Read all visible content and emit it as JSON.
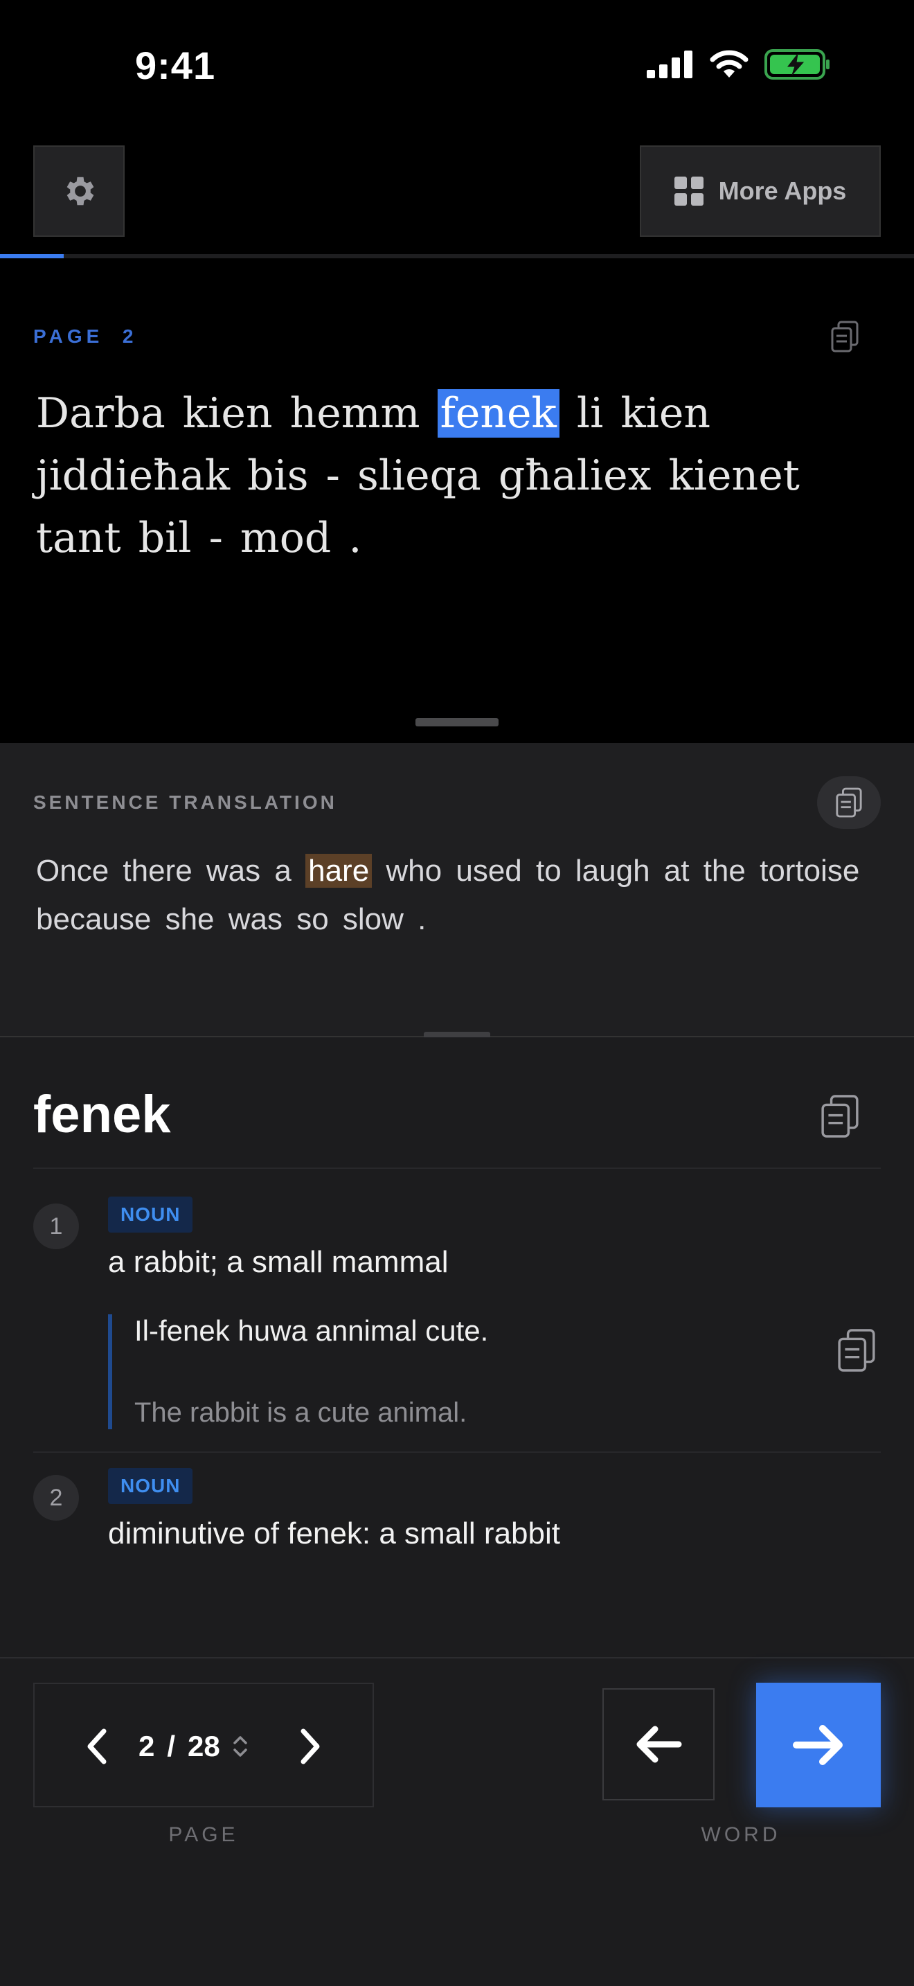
{
  "status_bar": {
    "time": "9:41"
  },
  "toolbar": {
    "more_apps_label": "More Apps"
  },
  "progress": {
    "fraction": 0.07
  },
  "reader": {
    "page_label": "PAGE  2",
    "sentence_before": "Darba kien hemm",
    "highlighted_word": "fenek",
    "sentence_after": "li kien jiddieħak bis - slieqa għaliex kienet tant bil - mod ."
  },
  "translation": {
    "label": "SENTENCE TRANSLATION",
    "text_before": "Once there was a",
    "highlighted_word": "hare",
    "text_after": "who used to laugh at the tortoise because she was so slow ."
  },
  "dictionary": {
    "headword": "fenek",
    "senses": [
      {
        "number": "1",
        "pos": "NOUN",
        "definition": "a rabbit; a small mammal",
        "example": "Il-fenek huwa annimal cute.",
        "example_translation": "The rabbit is a cute animal."
      },
      {
        "number": "2",
        "pos": "NOUN",
        "definition": "diminutive of fenek: a small rabbit"
      }
    ]
  },
  "pager": {
    "current": "2",
    "separator": "/",
    "total": "28",
    "label": "PAGE"
  },
  "word_nav": {
    "label": "WORD"
  },
  "colors": {
    "accent": "#3b7cf0",
    "translation_highlight": "#5c4027",
    "badge_bg": "#14284a",
    "badge_text": "#3f8ef0"
  }
}
